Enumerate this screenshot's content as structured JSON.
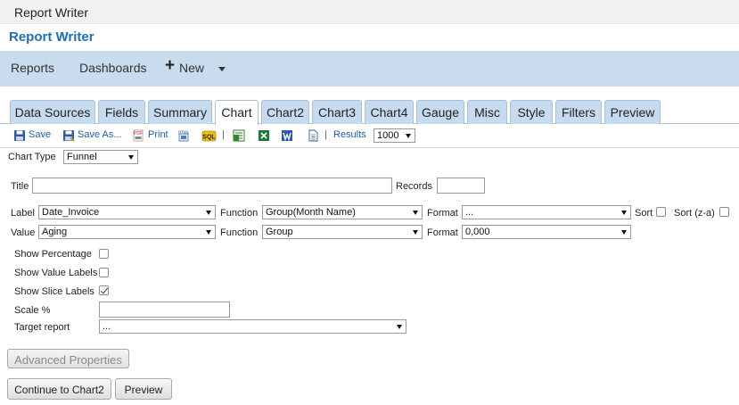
{
  "window": {
    "title": "Report Writer"
  },
  "page": {
    "heading": "Report Writer"
  },
  "nav": {
    "reports": "Reports",
    "dashboards": "Dashboards",
    "new": "New"
  },
  "tabs": [
    "Data Sources",
    "Fields",
    "Summary",
    "Chart",
    "Chart2",
    "Chart3",
    "Chart4",
    "Gauge",
    "Misc",
    "Style",
    "Filters",
    "Preview"
  ],
  "active_tab": "Chart",
  "toolbar": {
    "save": "Save",
    "save_as": "Save As...",
    "print": "Print",
    "pdf_icon": "PDF",
    "html_icon": "HTML",
    "sql_icon": "SQL",
    "separator": "|",
    "results_label": "Results",
    "results_value": "1000"
  },
  "form": {
    "chart_type_label": "Chart Type",
    "chart_type_value": "Funnel",
    "title_label": "Title",
    "title_value": "",
    "records_label": "Records",
    "records_value": "",
    "label_label": "Label",
    "label_value": "Date_Invoice",
    "function_label": "Function",
    "label_function_value": "Group(Month Name)",
    "format_label": "Format",
    "label_format_value": "...",
    "sort_label": "Sort",
    "sort_za_label": "Sort (z-a)",
    "value_label": "Value",
    "value_value": "Aging",
    "value_function_value": "Group",
    "value_format_value": "0,000",
    "show_percentage": "Show Percentage",
    "show_value_labels": "Show Value Labels",
    "show_slice_labels": "Show Slice Labels",
    "show_slice_labels_checked": true,
    "scale_label": "Scale %",
    "scale_value": "",
    "target_report_label": "Target report",
    "target_report_value": "..."
  },
  "buttons": {
    "advanced": "Advanced Properties",
    "continue": "Continue to Chart2",
    "preview": "Preview"
  }
}
